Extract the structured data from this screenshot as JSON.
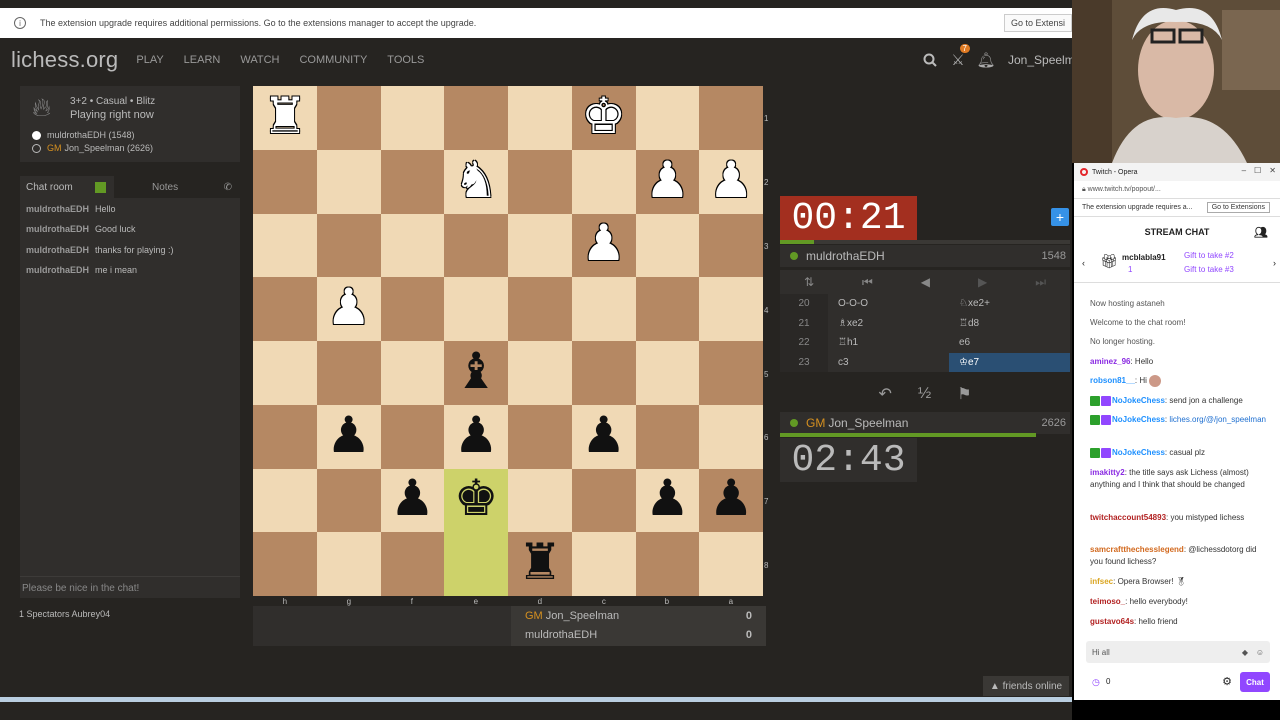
{
  "notice": {
    "text": "The extension upgrade requires additional permissions. Go to the extensions manager to accept the upgrade.",
    "button": "Go to Extensi"
  },
  "nav": {
    "logo": "lichess.org",
    "items": [
      "PLAY",
      "LEARN",
      "WATCH",
      "COMMUNITY",
      "TOOLS"
    ],
    "badge": "7",
    "username": "Jon_Speelman"
  },
  "game": {
    "type": "3+2 • Casual • Blitz",
    "status": "Playing right now",
    "white_player": "muldrothaEDH (1548)",
    "black_title": "GM",
    "black_player": "Jon_Speelman (2626)"
  },
  "chat": {
    "tab_chat": "Chat room",
    "tab_notes": "Notes",
    "messages": [
      {
        "user": "muldrothaEDH",
        "text": "Hello"
      },
      {
        "user": "muldrothaEDH",
        "text": "Good luck"
      },
      {
        "user": "muldrothaEDH",
        "text": "thanks for playing :)"
      },
      {
        "user": "muldrothaEDH",
        "text": "me i mean"
      }
    ],
    "placeholder": "Please be nice in the chat!",
    "spectators": "1 Spectators",
    "spectator_name": "Aubrey04"
  },
  "board": {
    "files": [
      "h",
      "g",
      "f",
      "e",
      "d",
      "c",
      "b",
      "a"
    ],
    "ranks": [
      "1",
      "2",
      "3",
      "4",
      "5",
      "6",
      "7",
      "8"
    ]
  },
  "material": {
    "title": "GM",
    "top_name": "Jon_Speelman",
    "top_score": "0",
    "bottom_name": "muldrothaEDH",
    "bottom_score": "0"
  },
  "clocks": {
    "top": "00:21",
    "bottom": "02:43"
  },
  "players": {
    "top_name": "muldrothaEDH",
    "top_rating": "1548",
    "bottom_title": "GM",
    "bottom_name": "Jon_Speelman",
    "bottom_rating": "2626"
  },
  "moves": [
    {
      "n": "20",
      "w": "O-O-O",
      "b": "♘xe2+"
    },
    {
      "n": "21",
      "w": "♗xe2",
      "b": "♖d8"
    },
    {
      "n": "22",
      "w": "♖h1",
      "b": "e6"
    },
    {
      "n": "23",
      "w": "c3",
      "b": "♔e7"
    }
  ],
  "actions": {
    "draw": "½"
  },
  "friends": "friends online",
  "twitch": {
    "window_title": "Twitch - Opera",
    "url": "www.twitch.tv/popout/...",
    "notice": "The extension upgrade requires a...",
    "notice_button": "Go to Extensions",
    "stream_chat": "STREAM CHAT",
    "gift_user": "mcblabla91",
    "gift_count": "1",
    "gift1": "Gift to take #2",
    "gift2": "Gift to take #3",
    "messages": [
      {
        "user": "",
        "text": "Now hosting astaneh",
        "color": "#555"
      },
      {
        "user": "",
        "text": "Welcome to the chat room!",
        "color": "#555"
      },
      {
        "user": "",
        "text": "No longer hosting.",
        "color": "#555"
      },
      {
        "user": "aminez_96",
        "text": "Hello",
        "color": "#8a2be2"
      },
      {
        "user": "robson81__",
        "text": "Hi",
        "color": "#1e90ff"
      },
      {
        "user": "NoJokeChess",
        "text": "send jon a challenge",
        "color": "#1e90ff"
      },
      {
        "user": "NoJokeChess",
        "text": "liches.org/@/jon_speelman",
        "color": "#1e90ff"
      },
      {
        "user": "NoJokeChess",
        "text": "casual plz",
        "color": "#1e90ff"
      },
      {
        "user": "imakitty2",
        "text": "the title says ask Lichess (almost) anything and I think that should be changed",
        "color": "#8a2be2"
      },
      {
        "user": "twitchaccount54893",
        "text": "you mistyped lichess",
        "color": "#b22222"
      },
      {
        "user": "samcraftthechesslegend",
        "text": "@lichessdotorg did you found lichess?",
        "color": "#d2691e"
      },
      {
        "user": "infsec",
        "text": "Opera Browser!",
        "color": "#daa520"
      },
      {
        "user": "teimoso_",
        "text": "hello everybody!",
        "color": "#b22222"
      },
      {
        "user": "gustavo64s",
        "text": "hello friend",
        "color": "#b22222"
      }
    ],
    "input": "Hi all",
    "points": "0",
    "chat_button": "Chat"
  }
}
